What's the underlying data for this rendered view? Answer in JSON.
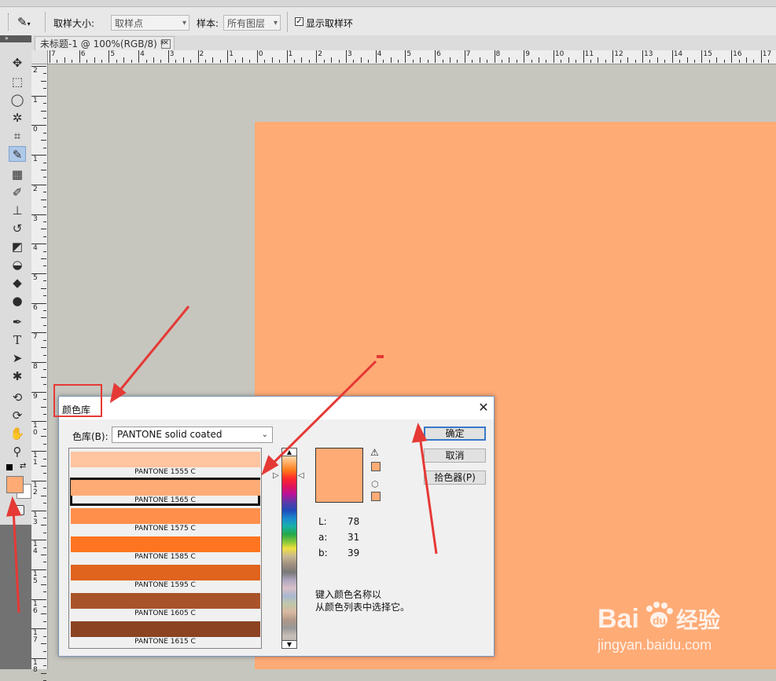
{
  "options_bar": {
    "sample_size_label": "取样大小:",
    "sample_size_value": "取样点",
    "sample_label": "样本:",
    "sample_value": "所有图层",
    "show_ring_label": "显示取样环",
    "show_ring_checked": true
  },
  "doc_tab": {
    "title": "未标题-1 @ 100%(RGB/8) *"
  },
  "ruler_top": [
    "7",
    "6",
    "5",
    "4",
    "3",
    "2",
    "1",
    "0",
    "1",
    "2",
    "3",
    "4",
    "5",
    "6",
    "7",
    "8",
    "9",
    "10",
    "11",
    "12",
    "13",
    "14",
    "15",
    "16",
    "17"
  ],
  "ruler_left": [
    "2",
    "1",
    "0",
    "1",
    "2",
    "3",
    "4",
    "5",
    "6",
    "7",
    "8",
    "9",
    "1 0",
    "1 1",
    "1 2",
    "1 3",
    "1 4",
    "1 5",
    "1 6",
    "1 7",
    "1 8"
  ],
  "colors": {
    "foreground": "#ffab76",
    "canvas": "#ffab76",
    "accent": "#3a78c8",
    "annotation": "#e53935"
  },
  "dialog": {
    "title": "颜色库",
    "book_label": "色库(B):",
    "book_value": "PANTONE solid coated",
    "buttons": {
      "ok": "确定",
      "cancel": "取消",
      "picker": "拾色器(P)"
    },
    "swatches": [
      {
        "name": "PANTONE 1555 C",
        "color": "#ffc4a0",
        "selected": false
      },
      {
        "name": "PANTONE 1565 C",
        "color": "#ffab76",
        "selected": true
      },
      {
        "name": "PANTONE 1575 C",
        "color": "#ff8f4a",
        "selected": false
      },
      {
        "name": "PANTONE 1585 C",
        "color": "#ff7420",
        "selected": false
      },
      {
        "name": "PANTONE 1595 C",
        "color": "#e0631e",
        "selected": false
      },
      {
        "name": "PANTONE 1605 C",
        "color": "#a9532a",
        "selected": false
      },
      {
        "name": "PANTONE 1615 C",
        "color": "#8b4322",
        "selected": false
      }
    ],
    "lab": {
      "L_label": "L:",
      "L": "78",
      "a_label": "a:",
      "a": "31",
      "b_label": "b:",
      "b": "39"
    },
    "hint_line1": "键入颜色名称以",
    "hint_line2": "从颜色列表中选择它。"
  },
  "icons": {
    "eyedropper": "eyedropper-icon",
    "move": "move-icon",
    "warning": "gamut-warning-icon",
    "cube": "web-safe-cube-icon"
  },
  "watermark": {
    "brand": "Baidu",
    "cn": "经验",
    "url": "jingyan.baidu.com"
  }
}
